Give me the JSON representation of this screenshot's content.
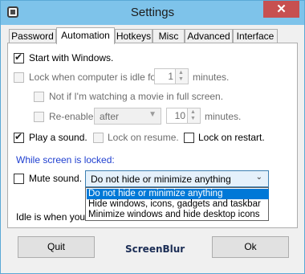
{
  "window": {
    "title": "Settings",
    "close_glyph": "✕"
  },
  "tabs": [
    "Password",
    "Automation",
    "Hotkeys",
    "Misc",
    "Advanced",
    "Interface"
  ],
  "active_tab": "Automation",
  "options": {
    "start_with_windows": {
      "label": "Start with Windows.",
      "checked": true
    },
    "lock_when_idle": {
      "label": "Lock when computer is idle for",
      "value": "1",
      "suffix": "minutes.",
      "checked": false
    },
    "not_if_movie": {
      "label": "Not if I'm watching a movie in full screen.",
      "checked": false
    },
    "reenable": {
      "label": "Re-enable",
      "select_value": "after",
      "value": "10",
      "suffix": "minutes.",
      "checked": false
    },
    "play_sound": {
      "label": "Play a sound.",
      "checked": true
    },
    "lock_on_resume": {
      "label": "Lock on resume.",
      "checked": false
    },
    "lock_on_restart": {
      "label": "Lock on restart.",
      "checked": false
    }
  },
  "locked_section": {
    "heading": "While screen is locked:",
    "mute_sound": {
      "label": "Mute sound.",
      "checked": false
    },
    "screen_option": {
      "selected": "Do not hide or minimize anything",
      "options": [
        "Do not hide or minimize anything",
        "Hide windows, icons, gadgets and taskbar",
        "Minimize windows and hide desktop icons"
      ]
    },
    "idle_note": "Idle is when you d"
  },
  "footer": {
    "quit_label": "Quit",
    "brand": "ScreenBlur",
    "ok_label": "Ok"
  },
  "colors": {
    "titlebar": "#7ec3ea",
    "close": "#c75050",
    "selection": "#0078d7",
    "heading": "#1f3fd0"
  }
}
